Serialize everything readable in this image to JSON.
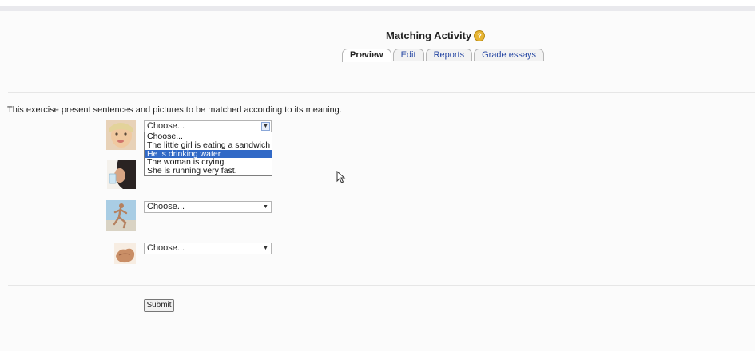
{
  "header": {
    "title": "Matching Activity",
    "help_icon": "help-icon"
  },
  "tabs": [
    {
      "label": "Preview",
      "active": true
    },
    {
      "label": "Edit",
      "active": false
    },
    {
      "label": "Reports",
      "active": false
    },
    {
      "label": "Grade essays",
      "active": false
    }
  ],
  "intro": "This exercise present sentences and pictures to be matched according to its meaning.",
  "questions": [
    {
      "image": "girl-photo",
      "selected": "Choose..."
    },
    {
      "image": "man-drinking-photo",
      "selected": "Choose..."
    },
    {
      "image": "runner-photo",
      "selected": "Choose..."
    },
    {
      "image": "hands-photo",
      "selected": "Choose..."
    }
  ],
  "dropdown": {
    "open_for_question": 1,
    "options": [
      "Choose...",
      "The little girl is eating a sandwich",
      "He is drinking water",
      "The woman is crying.",
      "She is running very fast."
    ],
    "highlighted": "He is drinking water"
  },
  "submit_label": "Submit",
  "colors": {
    "highlight": "#3169c6",
    "tab_link": "#2647a3",
    "help_icon": "#e7b533"
  }
}
